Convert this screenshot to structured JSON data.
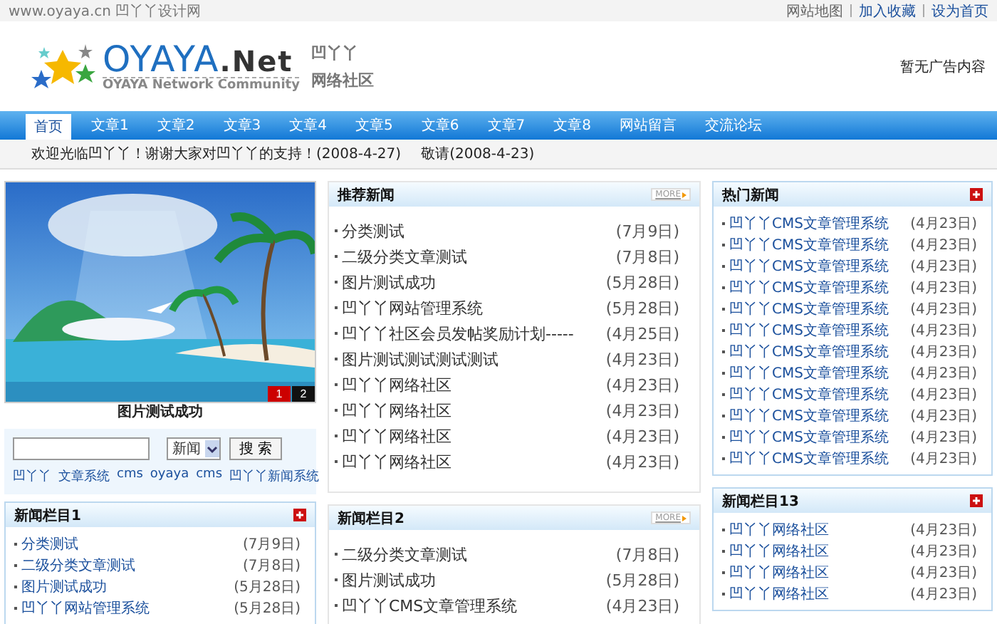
{
  "top_bar": {
    "site_text": "www.oyaya.cn 凹丫丫设计网",
    "links": [
      "网站地图",
      "加入收藏",
      "设为首页"
    ]
  },
  "header": {
    "logo": {
      "title": "OYAYA",
      "suffix": ".Net",
      "tagline": "OYAYA Network Community",
      "cn_line1": "凹丫丫",
      "cn_line2": "网络社区"
    },
    "ad_text": "暂无广告内容"
  },
  "nav": [
    {
      "label": "首页",
      "selected": true
    },
    {
      "label": "文章1",
      "selected": false
    },
    {
      "label": "文章2",
      "selected": false
    },
    {
      "label": "文章3",
      "selected": false
    },
    {
      "label": "文章4",
      "selected": false
    },
    {
      "label": "文章5",
      "selected": false
    },
    {
      "label": "文章6",
      "selected": false
    },
    {
      "label": "文章7",
      "selected": false
    },
    {
      "label": "文章8",
      "selected": false
    },
    {
      "label": "网站留言",
      "selected": false
    },
    {
      "label": "交流论坛",
      "selected": false
    }
  ],
  "ticker": [
    "欢迎光临凹丫丫！谢谢大家对凹丫丫的支持！(2008-4-27)",
    "敬请(2008-4-23)"
  ],
  "slideshow": {
    "kind": "picture",
    "caption": "图片测试成功",
    "pages": [
      {
        "label": "1",
        "selected": true
      },
      {
        "label": "2",
        "selected": false
      }
    ]
  },
  "search": {
    "select_value": "新闻",
    "button": "搜 索",
    "links": [
      "凹丫丫",
      "文章系统",
      "cms",
      "oyaya",
      "cms",
      "凹丫丫新闻系统"
    ]
  },
  "columns": [
    [
      {
        "title": "新闻栏目1",
        "action": {
          "kind": "plus"
        },
        "items": [
          {
            "title": "分类测试",
            "date": "(7月9日)"
          },
          {
            "title": "二级分类文章测试",
            "date": "(7月8日)"
          },
          {
            "title": "图片测试成功",
            "date": "(5月28日)"
          },
          {
            "title": "凹丫丫网站管理系统",
            "date": "(5月28日)"
          }
        ]
      }
    ],
    [
      {
        "title": "推荐新闻",
        "action": {
          "kind": "more",
          "label": "MORE"
        },
        "items": [
          {
            "title": "分类测试",
            "date": "(7月9日)"
          },
          {
            "title": "二级分类文章测试",
            "date": "(7月8日)"
          },
          {
            "title": "图片测试成功",
            "date": "(5月28日)"
          },
          {
            "title": "凹丫丫网站管理系统",
            "date": "(5月28日)"
          },
          {
            "title": "凹丫丫社区会员发帖奖励计划-----",
            "date": "(4月25日)"
          },
          {
            "title": "图片测试测试测试测试",
            "date": "(4月23日)"
          },
          {
            "title": "凹丫丫网络社区",
            "date": "(4月23日)"
          },
          {
            "title": "凹丫丫网络社区",
            "date": "(4月23日)"
          },
          {
            "title": "凹丫丫网络社区",
            "date": "(4月23日)"
          },
          {
            "title": "凹丫丫网络社区",
            "date": "(4月23日)"
          }
        ]
      },
      {
        "title": "新闻栏目2",
        "action": {
          "kind": "more",
          "label": "MORE"
        },
        "items": [
          {
            "title": "二级分类文章测试",
            "date": "(7月8日)"
          },
          {
            "title": "图片测试成功",
            "date": "(5月28日)"
          },
          {
            "title": "凹丫丫CMS文章管理系统",
            "date": "(4月23日)"
          }
        ]
      }
    ],
    [
      {
        "title": "热门新闻",
        "action": {
          "kind": "plus"
        },
        "items": [
          {
            "title": "凹丫丫CMS文章管理系统",
            "date": "(4月23日)"
          },
          {
            "title": "凹丫丫CMS文章管理系统",
            "date": "(4月23日)"
          },
          {
            "title": "凹丫丫CMS文章管理系统",
            "date": "(4月23日)"
          },
          {
            "title": "凹丫丫CMS文章管理系统",
            "date": "(4月23日)"
          },
          {
            "title": "凹丫丫CMS文章管理系统",
            "date": "(4月23日)"
          },
          {
            "title": "凹丫丫CMS文章管理系统",
            "date": "(4月23日)"
          },
          {
            "title": "凹丫丫CMS文章管理系统",
            "date": "(4月23日)"
          },
          {
            "title": "凹丫丫CMS文章管理系统",
            "date": "(4月23日)"
          },
          {
            "title": "凹丫丫CMS文章管理系统",
            "date": "(4月23日)"
          },
          {
            "title": "凹丫丫CMS文章管理系统",
            "date": "(4月23日)"
          },
          {
            "title": "凹丫丫CMS文章管理系统",
            "date": "(4月23日)"
          },
          {
            "title": "凹丫丫CMS文章管理系统",
            "date": "(4月23日)"
          }
        ]
      },
      {
        "title": "新闻栏目13",
        "action": {
          "kind": "plus"
        },
        "items": [
          {
            "title": "凹丫丫网络社区",
            "date": "(4月23日)"
          },
          {
            "title": "凹丫丫网络社区",
            "date": "(4月23日)"
          },
          {
            "title": "凹丫丫网络社区",
            "date": "(4月23日)"
          },
          {
            "title": "凹丫丫网络社区",
            "date": "(4月23日)"
          }
        ]
      }
    ]
  ]
}
